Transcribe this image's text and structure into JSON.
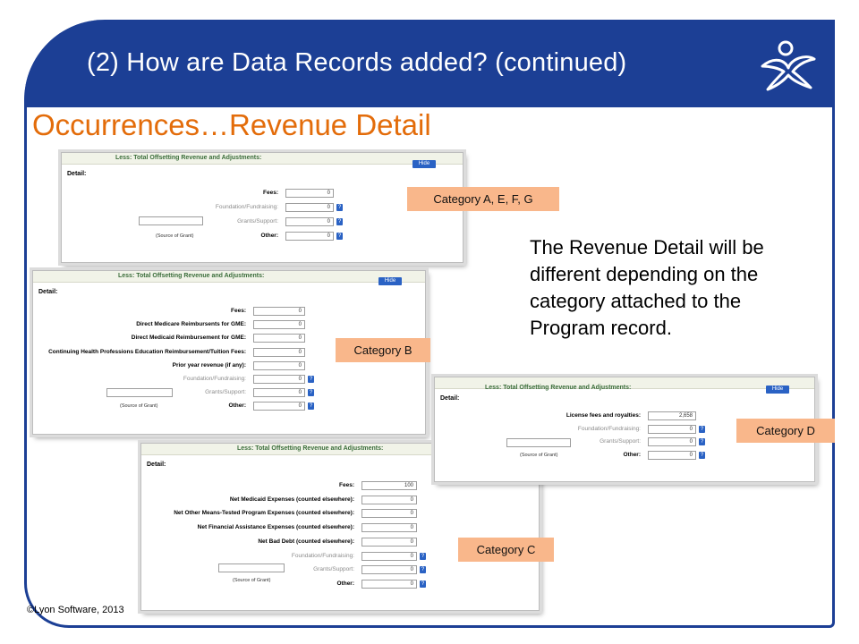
{
  "header": {
    "title": "(2)  How are Data Records added?  (continued)",
    "logo_icon": "lyon-software-logo-icon"
  },
  "section_title": "Occurrences…Revenue  Detail",
  "description": "The Revenue Detail will be different depending on the category attached to the Program record.",
  "copyright": "©Lyon Software, 2013",
  "colors": {
    "header": "#1c3f95",
    "section_title": "#e36c0a",
    "category_tag": "#f9b78b",
    "button": "#2a62c4"
  },
  "panel_common": {
    "heading": "Less: Total Offsetting Revenue and Adjustments:",
    "hide_label": "Hide",
    "detail_label": "Detail:",
    "help_glyph": "?",
    "source_label": "(Source of Grant)"
  },
  "panel_a": {
    "category": "Category A, E, F, G",
    "rows": [
      {
        "label": "Fees:",
        "value": "0",
        "muted": false,
        "help": false
      },
      {
        "label": "Foundation/Fundraising:",
        "value": "0",
        "muted": true,
        "help": true
      },
      {
        "label": "Grants/Support:",
        "value": "0",
        "muted": true,
        "help": true
      },
      {
        "label": "Other:",
        "value": "0",
        "muted": false,
        "help": true
      }
    ]
  },
  "panel_b": {
    "category": "Category B",
    "rows": [
      {
        "label": "Fees:",
        "value": "0",
        "muted": false,
        "help": false
      },
      {
        "label": "Direct Medicare Reimbursents for GME:",
        "value": "0",
        "muted": false,
        "help": false
      },
      {
        "label": "Direct Medicaid Reimbursement for GME:",
        "value": "0",
        "muted": false,
        "help": false
      },
      {
        "label": "Continuing Health Professions Education Reimbursement/Tuition Fees:",
        "value": "0",
        "muted": false,
        "help": false
      },
      {
        "label": "Prior year revenue (if any):",
        "value": "0",
        "muted": false,
        "help": false
      },
      {
        "label": "Foundation/Fundraising:",
        "value": "0",
        "muted": true,
        "help": true
      },
      {
        "label": "Grants/Support:",
        "value": "0",
        "muted": true,
        "help": true
      },
      {
        "label": "Other:",
        "value": "0",
        "muted": false,
        "help": true
      }
    ]
  },
  "panel_c": {
    "category": "Category C",
    "rows": [
      {
        "label": "Fees:",
        "value": "100",
        "muted": false,
        "help": false
      },
      {
        "label": "Net Medicaid Expenses (counted elsewhere):",
        "value": "0",
        "muted": false,
        "help": false
      },
      {
        "label": "Net Other Means-Tested Program Expenses (counted elsewhere):",
        "value": "0",
        "muted": false,
        "help": false
      },
      {
        "label": "Net Financial Assistance Expenses (counted elsewhere):",
        "value": "0",
        "muted": false,
        "help": false
      },
      {
        "label": "Net Bad Debt (counted elsewhere):",
        "value": "0",
        "muted": false,
        "help": false
      },
      {
        "label": "Foundation/Fundraising:",
        "value": "0",
        "muted": true,
        "help": true
      },
      {
        "label": "Grants/Support:",
        "value": "0",
        "muted": true,
        "help": true
      },
      {
        "label": "Other:",
        "value": "0",
        "muted": false,
        "help": true
      }
    ]
  },
  "panel_d": {
    "category": "Category D",
    "rows": [
      {
        "label": "License fees and royalties:",
        "value": "2,658",
        "muted": false,
        "help": false
      },
      {
        "label": "Foundation/Fundraising:",
        "value": "0",
        "muted": true,
        "help": true
      },
      {
        "label": "Grants/Support:",
        "value": "0",
        "muted": true,
        "help": true
      },
      {
        "label": "Other:",
        "value": "0",
        "muted": false,
        "help": true
      }
    ]
  }
}
